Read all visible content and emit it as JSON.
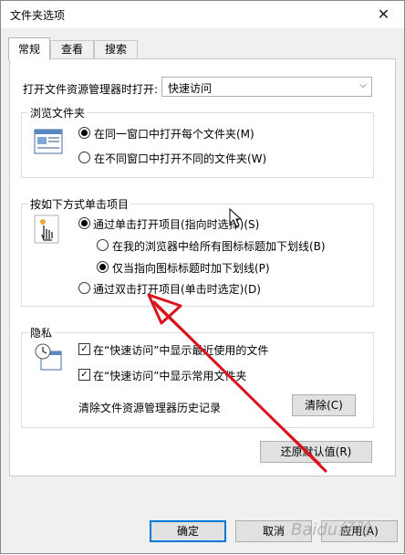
{
  "window": {
    "title": "文件夹选项",
    "close_icon": "close-icon"
  },
  "tabs": [
    {
      "label": "常规",
      "active": true
    },
    {
      "label": "查看",
      "active": false
    },
    {
      "label": "搜索",
      "active": false
    }
  ],
  "open_explorer": {
    "label": "打开文件资源管理器时打开:",
    "value": "快速访问"
  },
  "browse": {
    "title": "浏览文件夹",
    "options": [
      {
        "label": "在同一窗口中打开每个文件夹(M)",
        "selected": true
      },
      {
        "label": "在不同窗口中打开不同的文件夹(W)",
        "selected": false
      }
    ]
  },
  "click": {
    "title": "按如下方式单击项目",
    "single": {
      "label": "通过单击打开项目(指向时选择)(S)",
      "selected": true
    },
    "underline_all": {
      "label": "在我的浏览器中给所有图标标题加下划线(B)",
      "selected": false
    },
    "underline_hover": {
      "label": "仅当指向图标标题时加下划线(P)",
      "selected": true
    },
    "double": {
      "label": "通过双击打开项目(单击时选定)(D)",
      "selected": false
    }
  },
  "privacy": {
    "title": "隐私",
    "recent_files": {
      "label": "在“快速访问”中显示最近使用的文件",
      "checked": true
    },
    "frequent_folders": {
      "label": "在“快速访问”中显示常用文件夹",
      "checked": true
    },
    "clear_label": "清除文件资源管理器历史记录",
    "clear_button": "清除(C)"
  },
  "restore_defaults": "还原默认值(R)",
  "footer": {
    "ok": "确定",
    "cancel": "取消",
    "apply": "应用(A)"
  },
  "watermark": "Baidu经验",
  "colors": {
    "accent": "#0078d7",
    "arrow": "#d9141c"
  }
}
